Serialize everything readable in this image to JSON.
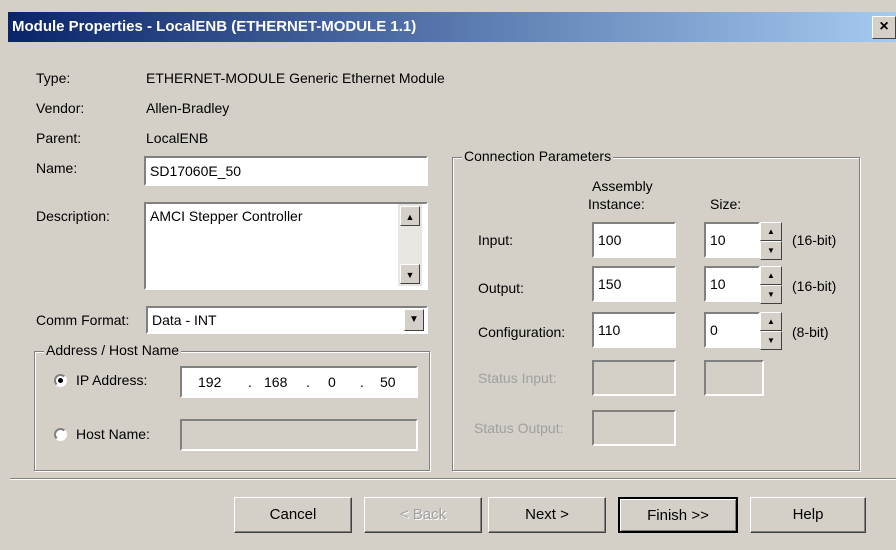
{
  "window": {
    "title": "Module Properties  - LocalENB (ETHERNET-MODULE 1.1)",
    "close": "×"
  },
  "info": {
    "type_label": "Type:",
    "type_value": "ETHERNET-MODULE Generic Ethernet Module",
    "vendor_label": "Vendor:",
    "vendor_value": "Allen-Bradley",
    "parent_label": "Parent:",
    "parent_value": "LocalENB"
  },
  "name": {
    "label": "Name:",
    "value": "SD17060E_50"
  },
  "description": {
    "label": "Description:",
    "value": "AMCI Stepper Controller"
  },
  "comm_format": {
    "label": "Comm Format:",
    "value": "Data - INT"
  },
  "address": {
    "legend": "Address / Host Name",
    "ip_label": "IP Address:",
    "ip_octets": [
      "192",
      "168",
      "0",
      "50"
    ],
    "ip_dot": ".",
    "host_label": "Host Name:",
    "host_value": "",
    "selected": "ip"
  },
  "connection": {
    "legend": "Connection Parameters",
    "col_assembly_1": "Assembly",
    "col_assembly_2": "Instance:",
    "col_size": "Size:",
    "rows": [
      {
        "label": "Input:",
        "instance": "100",
        "size": "10",
        "unit": "(16-bit)"
      },
      {
        "label": "Output:",
        "instance": "150",
        "size": "10",
        "unit": "(16-bit)"
      },
      {
        "label": "Configuration:",
        "instance": "110",
        "size": "0",
        "unit": "(8-bit)"
      }
    ],
    "status_input": "Status Input:",
    "status_output": "Status Output:"
  },
  "buttons": {
    "cancel": "Cancel",
    "back": "< Back",
    "next": "Next >",
    "finish": "Finish >>",
    "help": "Help"
  }
}
